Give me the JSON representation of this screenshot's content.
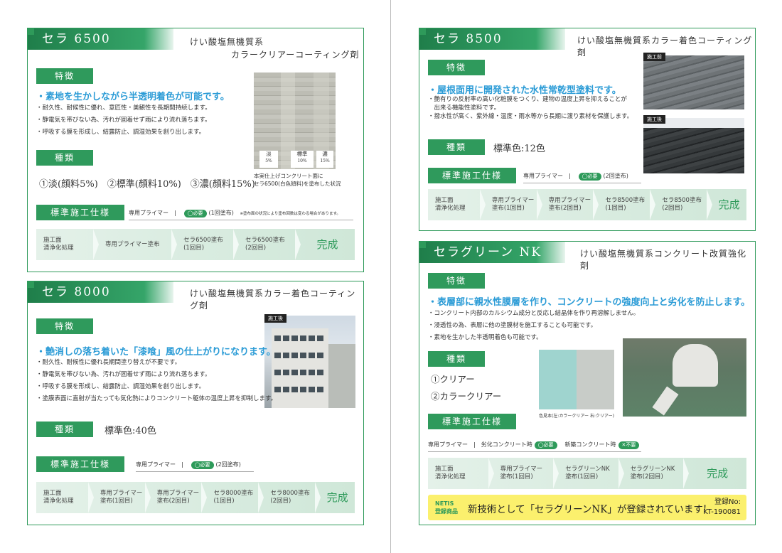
{
  "sera6500": {
    "title": "セラ 6500",
    "subtitle1": "けい酸塩無機質系",
    "subtitle2": "カラークリアーコーティング剤",
    "feature_label": "特徴",
    "lead": "・素地を生かしながら半透明着色が可能です。",
    "bullets": [
      "・耐久性、耐候性に優れ、意匠性・美観性を長期間持続します。",
      "・静電気を帯びない為、汚れが固着せず雨により流れ落ちます。",
      "・呼吸する膜を形成し、結露防止、調湿効果を創り出します。"
    ],
    "type_label": "種類",
    "types": "①淡(顔料5%)　②標準(顔料10%)　③濃(顔料15%)",
    "swatches": [
      {
        "name": "淡",
        "pct": "5%"
      },
      {
        "name": "標準",
        "pct": "10%"
      },
      {
        "name": "濃",
        "pct": "15%"
      }
    ],
    "caption1": "本実仕上げコンクリート面に",
    "caption2": "セラ6500(白色顔料)を塗布した状況",
    "spec_label": "標準施工仕様",
    "primer": "専用プライマー",
    "need": "必要",
    "coats": "(1回塗布)",
    "note": "※塗布面の状況により塗布回数は変わる場合があります。",
    "steps": [
      "施工面\n清浄化処理",
      "専用プライマー塗布",
      "セラ6500塗布\n(1回目)",
      "セラ6500塗布\n(2回目)",
      "完成"
    ]
  },
  "sera8000": {
    "title": "セラ 8000",
    "subtitle": "けい酸塩無機質系カラー着色コーティング剤",
    "feature_label": "特徴",
    "photo_tag": "施工後",
    "lead": "・艶消しの落ち着いた「漆喰」風の仕上がりになります。",
    "bullets": [
      "・耐久性、耐候性に優れ長期間塗り替えが不要です。",
      "・静電気を帯びない為、汚れが固着せず雨により流れ落ちます。",
      "・呼吸する膜を形成し、結露防止、調湿効果を創り出します。",
      "・塗膜表面に直射が当たっても気化熱によりコンクリート躯体の温度上昇を抑制します。"
    ],
    "type_label": "種類",
    "types": "標準色:40色",
    "spec_label": "標準施工仕様",
    "primer": "専用プライマー",
    "need": "必要",
    "coats": "(2回塗布)",
    "steps": [
      "施工面\n清浄化処理",
      "専用プライマー\n塗布(1回目)",
      "専用プライマー\n塗布(2回目)",
      "セラ8000塗布\n(1回目)",
      "セラ8000塗布\n(2回目)",
      "完成"
    ]
  },
  "sera8500": {
    "title": "セラ 8500",
    "subtitle": "けい酸塩無機質系カラー着色コーティング剤",
    "feature_label": "特徴",
    "lead": "・屋根面用に開発された水性常乾型塗料です。",
    "bullets": [
      "・艶有りの反射率の高い化粧膜をつくり、建物の温度上昇を抑えることが",
      "　出来る機能性塗料です。",
      "",
      "・撥水性が高く、紫外線・温度・雨水等から長期に渡り素材を保護します。"
    ],
    "tag_before": "施工前",
    "tag_after": "施工後",
    "type_label": "種類",
    "types": "標準色:12色",
    "spec_label": "標準施工仕様",
    "primer": "専用プライマー",
    "need": "必要",
    "coats": "(2回塗布)",
    "steps": [
      "施工面\n清浄化処理",
      "専用プライマー\n塗布(1回目)",
      "専用プライマー\n塗布(2回目)",
      "セラ8500塗布\n(1回目)",
      "セラ8500塗布\n(2回目)",
      "完成"
    ]
  },
  "seragreen": {
    "title": "セラグリーン NK",
    "subtitle": "けい酸塩無機質系コンクリート改質強化剤",
    "feature_label": "特徴",
    "lead": "・表層部に親水性膜層を作り、コンクリートの強度向上と劣化を防止します。",
    "bullets": [
      "・コンクリート内部のカルシウム成分と反応し結晶体を作り再溶解しません。",
      "・浸透性の為、表層に他の塗膜材を施工することも可能です。",
      "・素地を生かした半透明着色も可能です。"
    ],
    "type_label": "種類",
    "types": [
      "①クリアー",
      "②カラークリアー"
    ],
    "sample_caption": "色見本(左:カラークリアー 右:クリアー)",
    "spec_label": "標準施工仕様",
    "primer": "専用プライマー",
    "old": "劣化コンクリート時",
    "need": "必要",
    "new": "新築コンクリート時",
    "noneed": "不要",
    "steps": [
      "施工面\n清浄化処理",
      "専用プライマー\n塗布(1回目)",
      "セラグリーンNK\n塗布(1回目)",
      "セラグリーンNK\n塗布(2回目)",
      "完成"
    ],
    "netis1": "NETIS",
    "netis2": "登録商品",
    "netis_text": "新技術として「セラグリーンNK」が登録されています!",
    "reg_label": "登録No:",
    "reg_no": "KT-190081"
  }
}
